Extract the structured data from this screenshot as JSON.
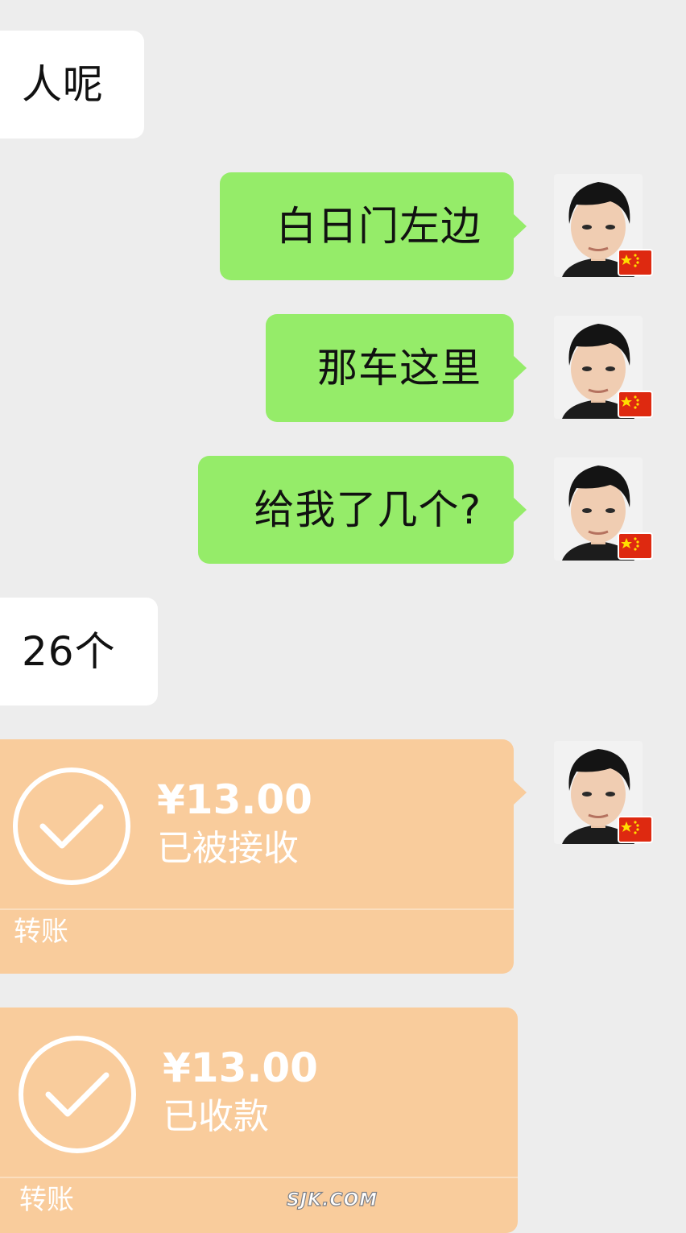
{
  "messages": [
    {
      "side": "left",
      "text": "人呢"
    },
    {
      "side": "right",
      "text": "白日门左边"
    },
    {
      "side": "right",
      "text": "那车这里"
    },
    {
      "side": "right",
      "text": "给我了几个?"
    },
    {
      "side": "left",
      "text": "26个"
    }
  ],
  "transfers": [
    {
      "amount": "¥13.00",
      "status": "已被接收",
      "label": "转账"
    },
    {
      "amount": "¥13.00",
      "status": "已收款",
      "label": "转账"
    }
  ],
  "avatar": {
    "icon": "user-avatar-icon",
    "badge": "china-flag-icon"
  },
  "colors": {
    "background": "#ededed",
    "incoming_bubble": "#ffffff",
    "outgoing_bubble": "#95ec69",
    "transfer_card": "#f9cc9c",
    "flag_red": "#de2910",
    "flag_star": "#ffde00"
  },
  "watermark": "SJK.COM"
}
